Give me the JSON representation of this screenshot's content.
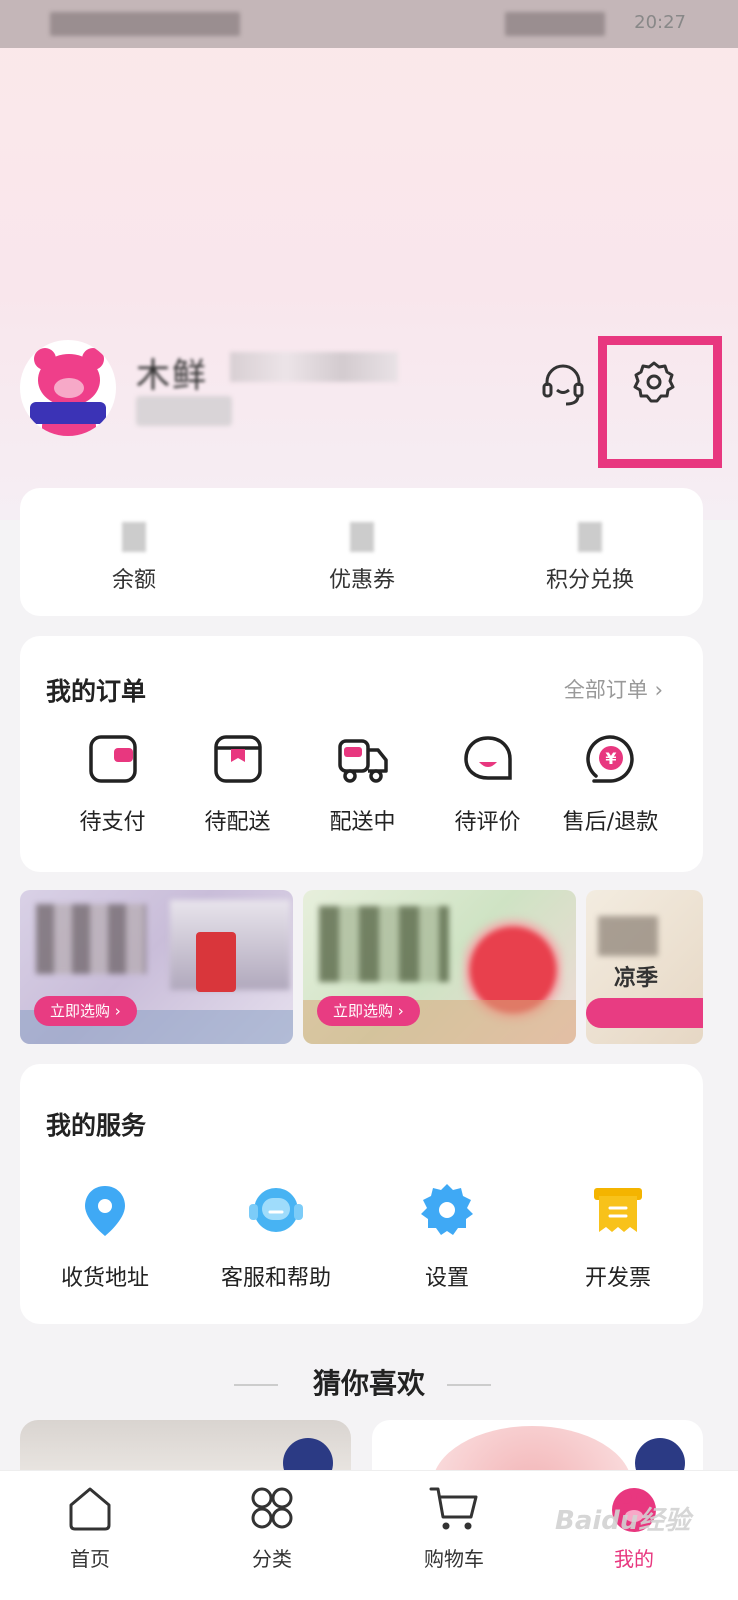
{
  "status_bar": {
    "time": "20:27"
  },
  "profile": {
    "name": "木鲜"
  },
  "header_actions": {
    "service_icon": "headset-icon",
    "settings_icon": "gear-icon",
    "highlight_color": "#e8377f"
  },
  "assets": [
    {
      "label": "余额"
    },
    {
      "label": "优惠券"
    },
    {
      "label": "积分兑换"
    }
  ],
  "orders": {
    "title": "我的订单",
    "all_label": "全部订单",
    "items": [
      {
        "label": "待支付",
        "icon": "wallet-icon"
      },
      {
        "label": "待配送",
        "icon": "package-icon"
      },
      {
        "label": "配送中",
        "icon": "truck-icon"
      },
      {
        "label": "待评价",
        "icon": "comment-icon"
      },
      {
        "label": "售后/退款",
        "icon": "refund-icon"
      }
    ]
  },
  "banners": [
    {
      "button": "立即选购"
    },
    {
      "button": "立即选购"
    },
    {
      "text": "凉季"
    }
  ],
  "services": {
    "title": "我的服务",
    "items": [
      {
        "label": "收货地址",
        "icon": "location-icon"
      },
      {
        "label": "客服和帮助",
        "icon": "customer-service-icon"
      },
      {
        "label": "设置",
        "icon": "gear-icon"
      },
      {
        "label": "开发票",
        "icon": "invoice-icon"
      }
    ]
  },
  "recommend": {
    "title": "猜你喜欢"
  },
  "tabbar": {
    "items": [
      {
        "label": "首页",
        "icon": "home-icon"
      },
      {
        "label": "分类",
        "icon": "category-icon"
      },
      {
        "label": "购物车",
        "icon": "cart-icon"
      },
      {
        "label": "我的",
        "icon": "profile-icon",
        "active": true
      }
    ]
  },
  "watermark": "Baidu经验",
  "accent_color": "#e8377f"
}
